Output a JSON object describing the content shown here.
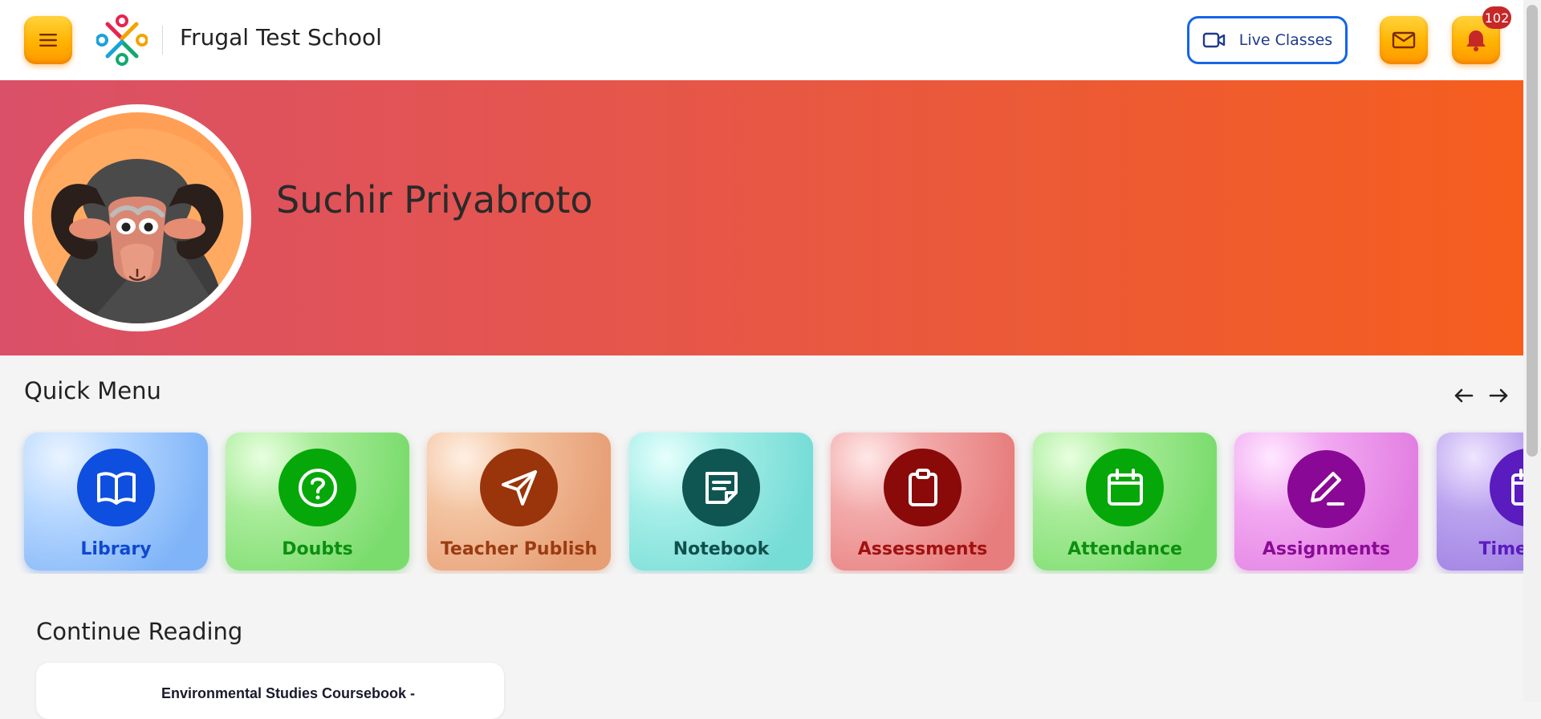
{
  "header": {
    "school_name": "Frugal Test School",
    "live_classes_label": "Live Classes",
    "notification_count": "102",
    "icons": [
      "hamburger-menu-icon",
      "school-logo",
      "video-camera-icon",
      "mail-icon",
      "bell-icon"
    ],
    "accent_color": "#ffb300",
    "live_button_color": "#1565e8"
  },
  "profile": {
    "student_name": "Suchir Priyabroto",
    "avatar": "ram-avatar",
    "banner_colors": [
      "#da5068",
      "#f65e1e"
    ]
  },
  "quick_menu": {
    "title": "Quick Menu",
    "prev_icon": "arrow-left-icon",
    "next_icon": "arrow-right-icon",
    "items": [
      {
        "label": "Library",
        "icon": "open-book-icon",
        "color": "#0e4fe0"
      },
      {
        "label": "Doubts",
        "icon": "question-circle-icon",
        "color": "#05a808"
      },
      {
        "label": "Teacher Publish",
        "icon": "paper-plane-icon",
        "color": "#9a340a"
      },
      {
        "label": "Notebook",
        "icon": "sticky-note-icon",
        "color": "#0f5653"
      },
      {
        "label": "Assessments",
        "icon": "clipboard-icon",
        "color": "#8a0909"
      },
      {
        "label": "Attendance",
        "icon": "calendar-icon",
        "color": "#05a808"
      },
      {
        "label": "Assignments",
        "icon": "pencil-icon",
        "color": "#8a0896"
      },
      {
        "label": "Timetable",
        "icon": "calendar-icon",
        "color": "#5a1bbf"
      }
    ]
  },
  "continue_reading": {
    "title": "Continue Reading",
    "items": [
      {
        "title": "Environmental Studies Coursebook -"
      }
    ]
  }
}
